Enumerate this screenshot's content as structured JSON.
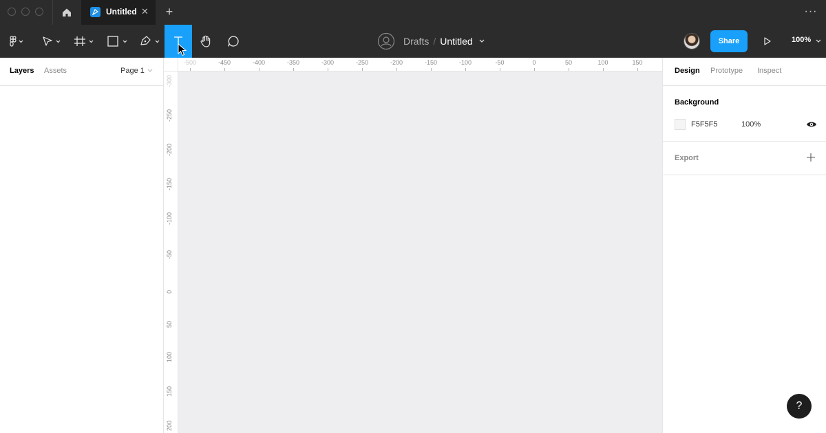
{
  "titlebar": {
    "tab_title": "Untitled",
    "close_glyph": "✕",
    "new_tab_glyph": "+",
    "more_glyph": "···"
  },
  "toolbar": {
    "tools": [
      "figma-menu",
      "move",
      "frame",
      "shape",
      "pen",
      "text",
      "hand",
      "comment"
    ],
    "active_tool": "text",
    "breadcrumb_folder": "Drafts",
    "breadcrumb_separator": "/",
    "breadcrumb_file": "Untitled",
    "share_label": "Share",
    "zoom_label": "100%"
  },
  "left_panel": {
    "tabs": [
      "Layers",
      "Assets"
    ],
    "page_selector": "Page 1"
  },
  "rulers": {
    "x_ticks": [
      "-500",
      "-450",
      "-400",
      "-350",
      "-300",
      "-250",
      "-200",
      "-150",
      "-100",
      "-50",
      "0",
      "50",
      "100",
      "150"
    ],
    "y_ticks": [
      "-300",
      "-250",
      "-200",
      "-150",
      "-100",
      "-50",
      "0",
      "50",
      "100",
      "150",
      "200"
    ]
  },
  "right_panel": {
    "tabs": [
      "Design",
      "Prototype",
      "Inspect"
    ],
    "background": {
      "title": "Background",
      "hex": "F5F5F5",
      "opacity": "100%",
      "color": "#F5F5F5"
    },
    "export": {
      "title": "Export"
    }
  },
  "help": {
    "label": "?"
  },
  "colors": {
    "accent": "#18A0FB",
    "chrome": "#2C2C2C",
    "canvas": "#EEEEF0"
  }
}
